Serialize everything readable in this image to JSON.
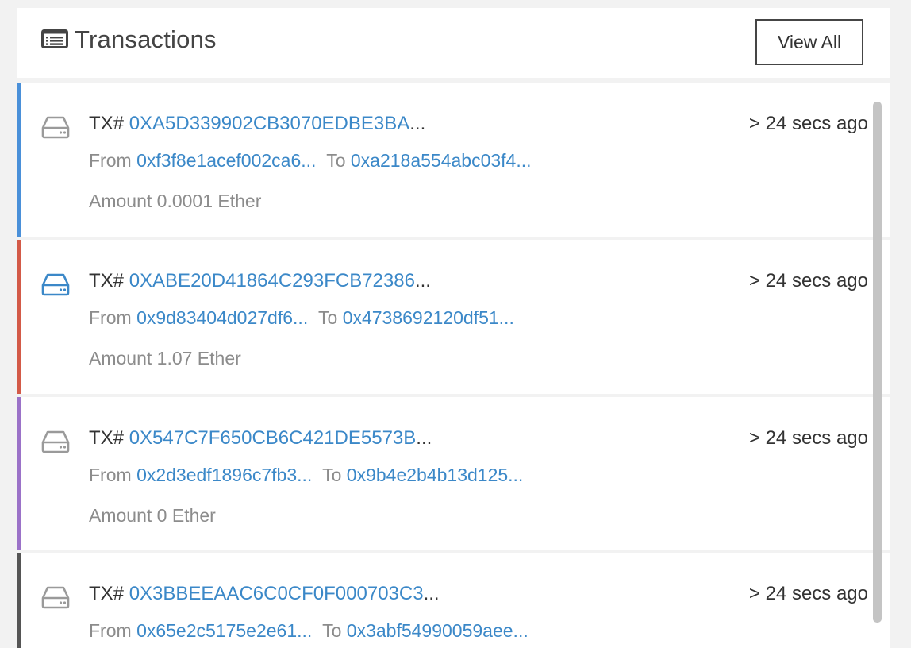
{
  "header": {
    "title": "Transactions",
    "view_all_label": "View All",
    "icon": "list-icon"
  },
  "transactions": [
    {
      "tx_label": "TX#",
      "hash": "0XA5D339902CB3070EDBE3BA",
      "ellipsis": "...",
      "time": "> 24 secs ago",
      "from_label": "From",
      "from": "0xf3f8e1acef002ca6...",
      "to_label": "To",
      "to": "0xa218a554abc03f4...",
      "amount": "Amount 0.0001 Ether",
      "accent_color": "#4a90d9",
      "icon_color": "#9a9a9a",
      "icon": "drive-icon"
    },
    {
      "tx_label": "TX#",
      "hash": "0XABE20D41864C293FCB72386",
      "ellipsis": "...",
      "time": "> 24 secs ago",
      "from_label": "From",
      "from": "0x9d83404d027df6...",
      "to_label": "To",
      "to": "0x4738692120df51...",
      "amount": "Amount 1.07 Ether",
      "accent_color": "#d35a48",
      "icon_color": "#3b88c8",
      "icon": "drive-icon"
    },
    {
      "tx_label": "TX#",
      "hash": "0X547C7F650CB6C421DE5573B",
      "ellipsis": "...",
      "time": "> 24 secs ago",
      "from_label": "From",
      "from": "0x2d3edf1896c7fb3...",
      "to_label": "To",
      "to": "0x9b4e2b4b13d125...",
      "amount": "Amount 0 Ether",
      "accent_color": "#9b72c8",
      "icon_color": "#9a9a9a",
      "icon": "drive-icon"
    },
    {
      "tx_label": "TX#",
      "hash": "0X3BBEEAAC6C0CF0F000703C3",
      "ellipsis": "...",
      "time": "> 24 secs ago",
      "from_label": "From",
      "from": "0x65e2c5175e2e61...",
      "to_label": "To",
      "to": "0x3abf54990059aee...",
      "amount": "",
      "accent_color": "#555555",
      "icon_color": "#9a9a9a",
      "icon": "drive-icon"
    }
  ]
}
